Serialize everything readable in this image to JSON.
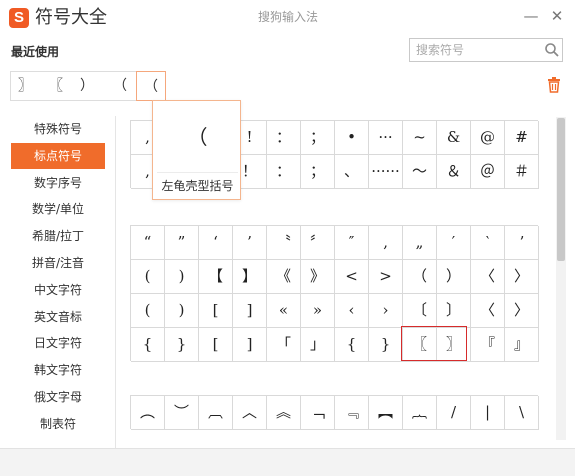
{
  "app": {
    "title": "符号大全",
    "window_title": "搜狗输入法",
    "minimize_glyph": "—",
    "close_glyph": "✕",
    "accent_color": "#f06c2b",
    "highlight_color": "#d62b2b"
  },
  "recent": {
    "label": "最近使用",
    "items": [
      "〗",
      "〖",
      "）",
      "（",
      "（"
    ],
    "selected_index": 4
  },
  "search": {
    "placeholder": "搜索符号",
    "value": ""
  },
  "sidebar": {
    "items": [
      {
        "label": "特殊符号"
      },
      {
        "label": "标点符号"
      },
      {
        "label": "数字序号"
      },
      {
        "label": "数学/单位"
      },
      {
        "label": "希腊/拉丁"
      },
      {
        "label": "拼音/注音"
      },
      {
        "label": "中文字符"
      },
      {
        "label": "英文音标"
      },
      {
        "label": "日文字符"
      },
      {
        "label": "韩文字符"
      },
      {
        "label": "俄文字母"
      },
      {
        "label": "制表符"
      }
    ],
    "active_index": 1
  },
  "blocks": [
    {
      "rows": [
        [
          ",",
          "。",
          "·",
          "!",
          "：",
          "；",
          "•",
          "···",
          "~",
          "&",
          "@",
          "#"
        ],
        [
          ",",
          "。",
          "·",
          "！",
          "：",
          "；",
          "、",
          "······",
          "～",
          "＆",
          "＠",
          "＃"
        ]
      ]
    },
    {
      "rows": [
        [
          "“",
          "”",
          "‘",
          "’",
          "〝",
          "〞",
          "″",
          "‚",
          "„",
          "′",
          "‵",
          "ʼ"
        ],
        [
          "(",
          ")",
          "【",
          "】",
          "《",
          "》",
          "<",
          ">",
          "（",
          "）",
          "〈",
          "〉"
        ],
        [
          "(",
          ")",
          "[",
          "]",
          "«",
          "»",
          "‹",
          "›",
          "〔",
          "〕",
          "〈",
          "〉"
        ],
        [
          "{",
          "}",
          "[",
          "]",
          "「",
          "」",
          "{",
          "}",
          "〖",
          "〗",
          "『",
          "』"
        ]
      ]
    },
    {
      "rows": [
        [
          "︵",
          "︶",
          "︹",
          "︿",
          "︽",
          "﹁",
          "﹃",
          "︻",
          "︷",
          "/",
          "|",
          "\\"
        ]
      ]
    }
  ],
  "tooltip": {
    "glyph": "（",
    "label": "左龟壳型括号"
  }
}
